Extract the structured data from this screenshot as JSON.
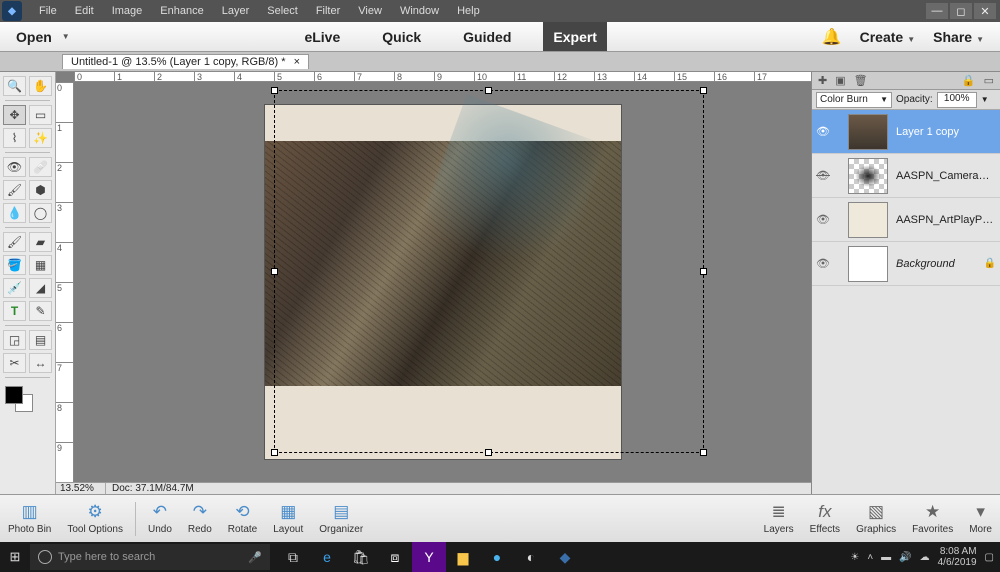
{
  "menu": {
    "items": [
      "File",
      "Edit",
      "Image",
      "Enhance",
      "Layer",
      "Select",
      "Filter",
      "View",
      "Window",
      "Help"
    ]
  },
  "modebar": {
    "open": "Open",
    "modes": {
      "elive": "eLive",
      "quick": "Quick",
      "guided": "Guided",
      "expert": "Expert"
    },
    "create": "Create",
    "share": "Share"
  },
  "document": {
    "tab_title": "Untitled-1 @ 13.5% (Layer 1 copy, RGB/8) *"
  },
  "status": {
    "zoom": "13.52%",
    "docinfo": "Doc: 37.1M/84.7M"
  },
  "hruler": [
    "0",
    "1",
    "2",
    "3",
    "4",
    "5",
    "6",
    "7",
    "8",
    "9",
    "10",
    "11",
    "12",
    "13",
    "14",
    "15",
    "16",
    "17"
  ],
  "vruler": [
    "0",
    "1",
    "2",
    "3",
    "4",
    "5",
    "6",
    "7",
    "8",
    "9"
  ],
  "layers_panel": {
    "blend_mode": "Color Burn",
    "opacity_label": "Opacity:",
    "opacity_value": "100%",
    "layers": [
      {
        "name": "Layer 1 copy",
        "visible": true,
        "selected": true,
        "thumb": "photo"
      },
      {
        "name": "AASPN_CameraFo...",
        "visible": false,
        "selected": false,
        "thumb": "blot"
      },
      {
        "name": "AASPN_ArtPlayPal...",
        "visible": true,
        "selected": false,
        "thumb": "paper"
      },
      {
        "name": "Background",
        "visible": true,
        "selected": false,
        "thumb": "white",
        "locked": true
      }
    ]
  },
  "bottom": {
    "photobin": "Photo Bin",
    "toolopts": "Tool Options",
    "undo": "Undo",
    "redo": "Redo",
    "rotate": "Rotate",
    "layout": "Layout",
    "organizer": "Organizer",
    "layers": "Layers",
    "effects": "Effects",
    "graphics": "Graphics",
    "favorites": "Favorites",
    "more": "More"
  },
  "taskbar": {
    "search_placeholder": "Type here to search",
    "time": "8:08 AM",
    "date": "4/6/2019"
  }
}
